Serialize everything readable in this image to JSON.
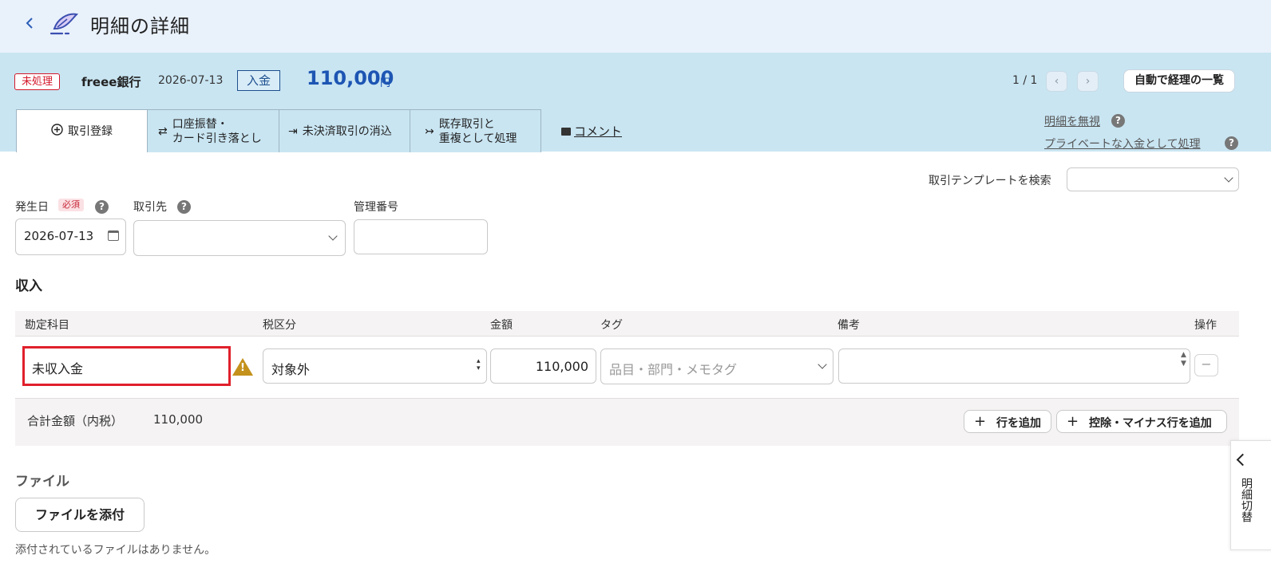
{
  "header": {
    "title": "明細の詳細",
    "back_icon": "chevron-left-icon",
    "logo_icon": "bird-logo-icon"
  },
  "statement": {
    "status": "未処理",
    "bank": "freee銀行",
    "date": "2026-07-13",
    "direction": "入金",
    "amount": "110,000",
    "unit": "円",
    "pager": "1 / 1",
    "prev": "‹",
    "next": "›",
    "auto_list": "自動で経理の一覧",
    "status_color": "#d3182b",
    "amount_color": "#1d55b3"
  },
  "tabs": [
    {
      "label": "取引登録",
      "icon": "⊕"
    },
    {
      "label_line1": "口座振替・",
      "label_line2": "カード引き落とし",
      "icon": "⇄"
    },
    {
      "label": "未決済取引の消込",
      "icon": "⇥"
    },
    {
      "label_line1": "既存取引と",
      "label_line2": "重複として処理",
      "icon": "↣"
    }
  ],
  "comment": {
    "label": "コメント"
  },
  "side_links": {
    "ignore": "明細を無視",
    "private": "プライベートな入金として処理",
    "help": "?"
  },
  "form": {
    "template_label": "取引テンプレートを検索",
    "date_label": "発生日",
    "required": "必須",
    "partner_label": "取引先",
    "mgmt_label": "管理番号",
    "date_value": "2026-07-13",
    "help": "?"
  },
  "income": {
    "heading": "収入",
    "columns": {
      "account": "勘定科目",
      "tax": "税区分",
      "amount": "金額",
      "tag": "タグ",
      "memo": "備考",
      "ops": "操作"
    },
    "row": {
      "account": "未収入金",
      "tax": "対象外",
      "amount": "110,000",
      "tag_placeholder": "品目・部門・メモタグ",
      "remove": "−"
    },
    "total_label": "合計金額（内税）",
    "total_value": "110,000",
    "add_row": "行を追加",
    "add_minus_row": "控除・マイナス行を追加",
    "plus": "+"
  },
  "files": {
    "heading": "ファイル",
    "attach": "ファイルを添付",
    "empty": "添付されているファイルはありません。"
  },
  "drawer": {
    "label": "明細切替"
  }
}
